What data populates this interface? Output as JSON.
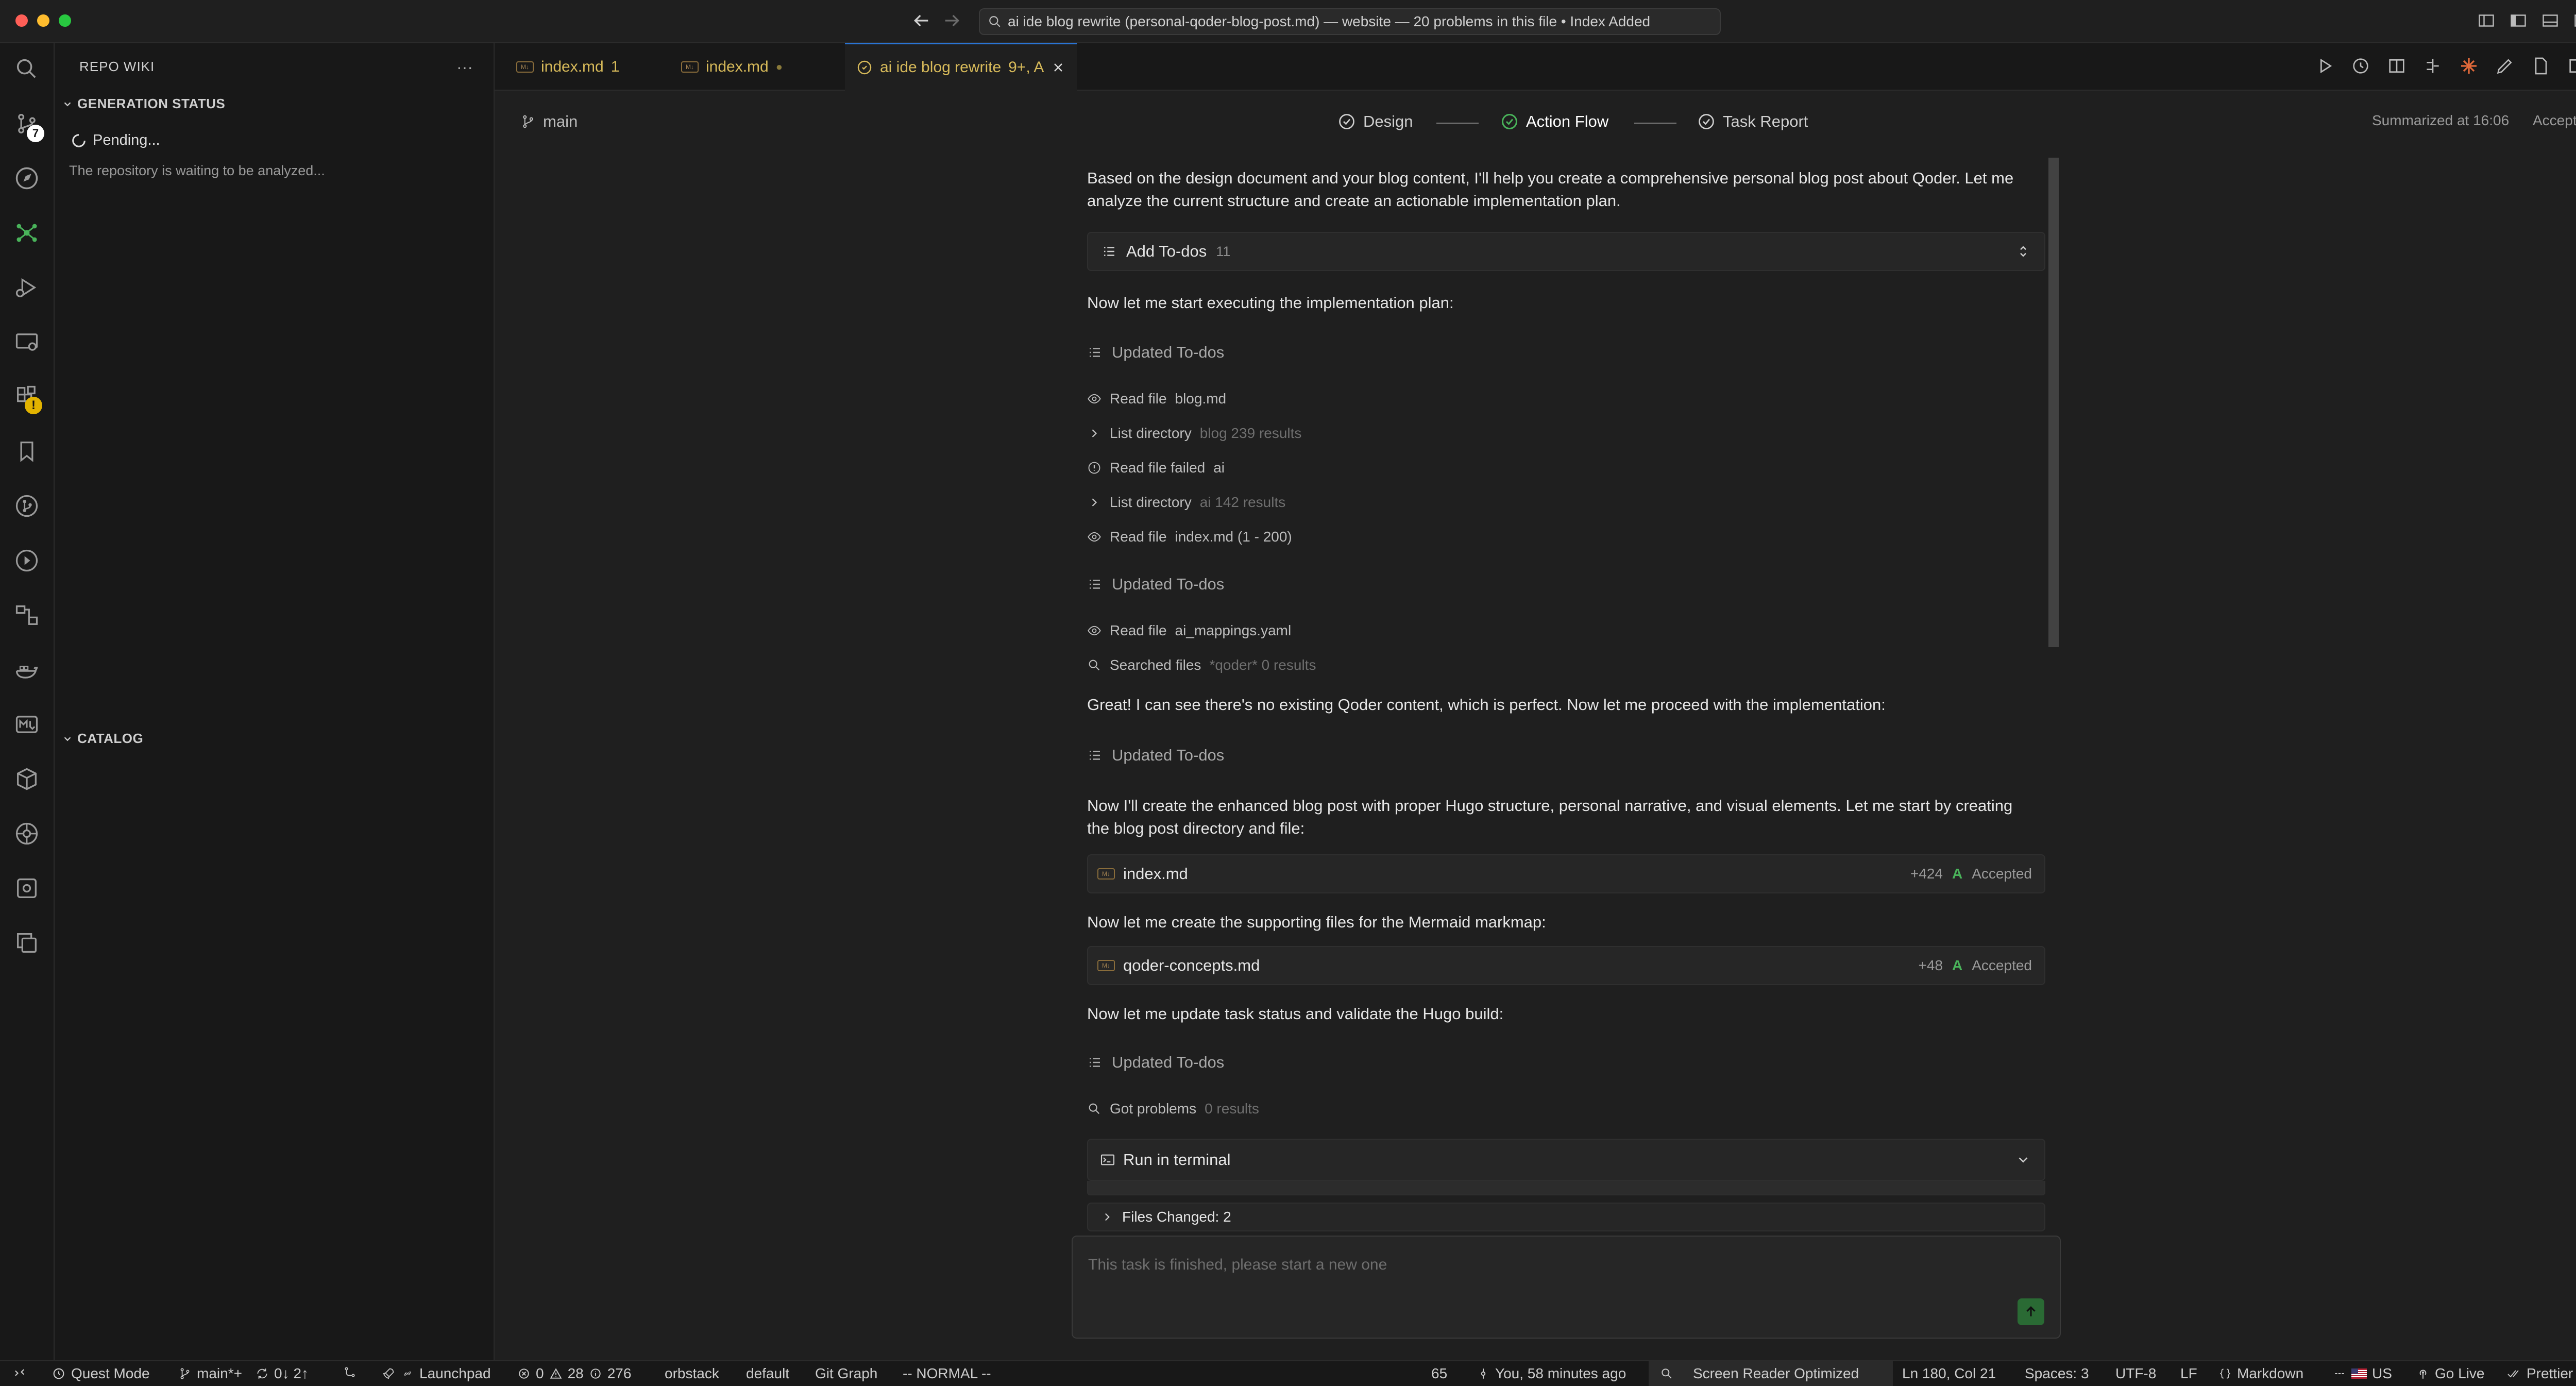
{
  "titlebar": {
    "command_center": "ai ide blog rewrite (personal-qoder-blog-post.md) — website — 20 problems in this file • Index Added"
  },
  "sidebar": {
    "title": "REPO WIKI",
    "more": "···",
    "generation_section": "GENERATION STATUS",
    "pending": "Pending...",
    "waiting": "The repository is waiting to be analyzed...",
    "catalog_section": "CATALOG"
  },
  "activity_bar": {
    "scm_badge": "7"
  },
  "tabs": [
    {
      "label": "index.md",
      "suffix": "1"
    },
    {
      "label": "index.md",
      "suffix": "●"
    },
    {
      "label": "ai ide blog rewrite",
      "suffix": "9+, A"
    }
  ],
  "flow": {
    "branch": "main",
    "steps": [
      "Design",
      "Action Flow",
      "Task Report"
    ],
    "summarized": "Summarized at 16:06",
    "accepted": "Accepted"
  },
  "chat": {
    "intro": "Based on the design document and your blog content, I'll help you create a comprehensive personal blog post about Qoder. Let me analyze the current structure and create an actionable implementation plan.",
    "add_todos_label": "Add To-dos",
    "add_todos_count": "11",
    "start_exec": "Now let me start executing the implementation plan:",
    "updated_todos": "Updated To-dos",
    "tool_rows": [
      {
        "action": "Read file",
        "target": "blog.md",
        "detail": ""
      },
      {
        "action": "List directory",
        "target": "",
        "detail": "blog 239 results"
      },
      {
        "action": "Read file failed",
        "target": "ai",
        "detail": ""
      },
      {
        "action": "List directory",
        "target": "",
        "detail": "ai 142 results"
      },
      {
        "action": "Read file",
        "target": "index.md (1 - 200)",
        "detail": ""
      }
    ],
    "read_mappings": {
      "action": "Read file",
      "target": "ai_mappings.yaml"
    },
    "searched": {
      "action": "Searched files",
      "detail": "*qoder* 0 results"
    },
    "great_msg": "Great! I can see there's no existing Qoder content, which is perfect. Now let me proceed with the implementation:",
    "enhanced_msg": "Now I'll create the enhanced blog post with proper Hugo structure, personal narrative, and visual elements. Let me start by creating the blog post directory and file:",
    "file1": {
      "name": "index.md",
      "diff": "+424",
      "flag": "A",
      "status": "Accepted"
    },
    "supporting_msg": "Now let me create the supporting files for the Mermaid markmap:",
    "file2": {
      "name": "qoder-concepts.md",
      "diff": "+48",
      "flag": "A",
      "status": "Accepted"
    },
    "update_msg": "Now let me update task status and validate the Hugo build:",
    "got_problems": {
      "action": "Got problems",
      "detail": "0 results"
    },
    "run_terminal": "Run in terminal",
    "files_changed": "Files Changed: 2",
    "input_placeholder": "This task is finished, please start a new one"
  },
  "statusbar": {
    "quest_mode": "Quest Mode",
    "branch": "main*+",
    "sync": "0↓ 2↑",
    "launchpad": "Launchpad",
    "errors": "0",
    "warnings": "28",
    "infos": "276",
    "orbstack": "orbstack",
    "default": "default",
    "git_graph": "Git Graph",
    "vim_mode": "-- NORMAL --",
    "count": "65",
    "blame": "You, 58 minutes ago",
    "screen_reader": "Screen Reader Optimized",
    "position": "Ln 180, Col 21",
    "spaces": "Spaces: 3",
    "encoding": "UTF-8",
    "eol": "LF",
    "language": "Markdown",
    "locale": "US",
    "go_live": "Go Live",
    "prettier": "Prettier"
  },
  "colors": {
    "accent_green": "#49b35a",
    "tab_label_yellow": "#d7ba5a",
    "background": "#1f1f1f"
  }
}
